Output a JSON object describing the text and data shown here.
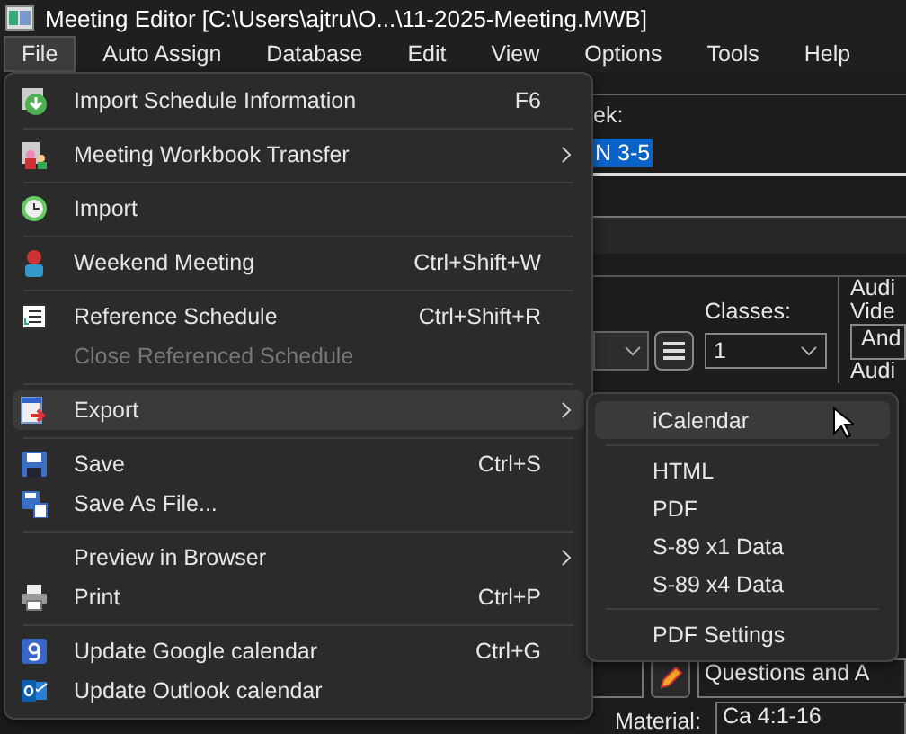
{
  "window": {
    "title": "Meeting Editor [C:\\Users\\ajtru\\O...\\11-2025-Meeting.MWB]"
  },
  "menu_bar": [
    {
      "label": "File",
      "selected": true
    },
    {
      "label": "Auto Assign",
      "selected": false
    },
    {
      "label": "Database",
      "selected": false
    },
    {
      "label": "Edit",
      "selected": false
    },
    {
      "label": "View",
      "selected": false
    },
    {
      "label": "Options",
      "selected": false
    },
    {
      "label": "Tools",
      "selected": false
    },
    {
      "label": "Help",
      "selected": false
    }
  ],
  "file_menu": [
    {
      "kind": "item",
      "label": "Import Schedule Information",
      "shortcut": "F6",
      "submenu": false,
      "disabled": false,
      "selected": false
    },
    {
      "kind": "separator"
    },
    {
      "kind": "item",
      "label": "Meeting Workbook Transfer",
      "submenu": true,
      "disabled": false,
      "selected": false
    },
    {
      "kind": "separator"
    },
    {
      "kind": "item",
      "label": "Import",
      "submenu": false,
      "disabled": false,
      "selected": false
    },
    {
      "kind": "separator"
    },
    {
      "kind": "item",
      "label": "Weekend Meeting",
      "shortcut": "Ctrl+Shift+W",
      "submenu": false,
      "disabled": false,
      "selected": false
    },
    {
      "kind": "separator"
    },
    {
      "kind": "item",
      "label": "Reference Schedule",
      "shortcut": "Ctrl+Shift+R",
      "submenu": false,
      "disabled": false,
      "selected": false
    },
    {
      "kind": "item",
      "label": "Close Referenced Schedule",
      "submenu": false,
      "disabled": true,
      "selected": false
    },
    {
      "kind": "separator"
    },
    {
      "kind": "item",
      "label": "Export",
      "submenu": true,
      "disabled": false,
      "selected": true
    },
    {
      "kind": "separator"
    },
    {
      "kind": "item",
      "label": "Save",
      "shortcut": "Ctrl+S",
      "submenu": false,
      "disabled": false,
      "selected": false
    },
    {
      "kind": "item",
      "label": "Save As File...",
      "submenu": false,
      "disabled": false,
      "selected": false
    },
    {
      "kind": "separator"
    },
    {
      "kind": "item",
      "label": "Preview in Browser",
      "submenu": true,
      "disabled": false,
      "selected": false
    },
    {
      "kind": "item",
      "label": "Print",
      "shortcut": "Ctrl+P",
      "submenu": false,
      "disabled": false,
      "selected": false
    },
    {
      "kind": "separator"
    },
    {
      "kind": "item",
      "label": "Update Google calendar",
      "shortcut": "Ctrl+G",
      "submenu": false,
      "disabled": false,
      "selected": false
    },
    {
      "kind": "item",
      "label": "Update Outlook calendar",
      "submenu": false,
      "disabled": false,
      "selected": false
    }
  ],
  "export_submenu": [
    {
      "kind": "item",
      "label": "iCalendar",
      "selected": true
    },
    {
      "kind": "separator"
    },
    {
      "kind": "item",
      "label": "HTML",
      "selected": false
    },
    {
      "kind": "item",
      "label": "PDF",
      "selected": false
    },
    {
      "kind": "item",
      "label": "S-89 x1 Data",
      "selected": false
    },
    {
      "kind": "item",
      "label": "S-89 x4 Data",
      "selected": false
    },
    {
      "kind": "separator"
    },
    {
      "kind": "item",
      "label": "PDF Settings",
      "selected": false
    }
  ],
  "editor": {
    "week_label": "ek:",
    "week_field": {
      "value": "N 3-5",
      "selected": true
    },
    "classes": {
      "label": "Classes:",
      "value": "1"
    },
    "audio_labels": [
      "Audi",
      "Vide"
    ],
    "audio_field": "And",
    "audio_label_2": "Audi",
    "assignment_field": "Questions and A",
    "material": {
      "label": "Material:",
      "value": "Ca 4:1-16"
    }
  }
}
